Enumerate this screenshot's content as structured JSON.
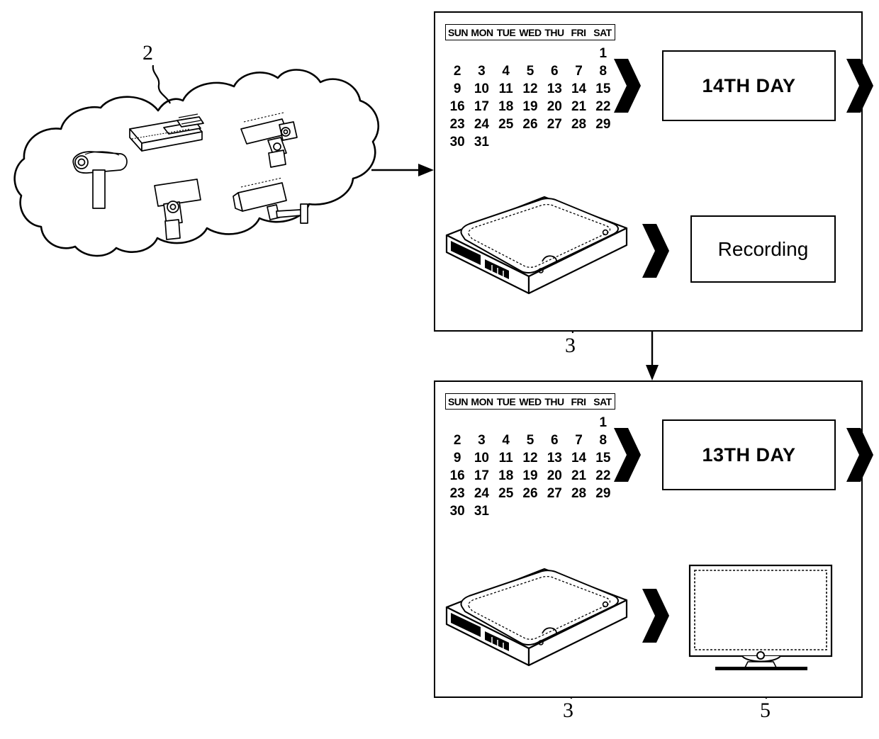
{
  "figure": {
    "type": "patent-diagram",
    "description": "Surveillance cloud with cameras feeding a recorder; two panels show day-14 recording and day-13 playback"
  },
  "cloud": {
    "label": "2",
    "name": "camera-network-cloud",
    "devices": [
      {
        "name": "network-recorder-device",
        "kind": "recorder"
      },
      {
        "name": "surveillance-camera-left",
        "kind": "camera"
      },
      {
        "name": "surveillance-camera-top-right",
        "kind": "camera"
      },
      {
        "name": "surveillance-camera-center",
        "kind": "camera"
      },
      {
        "name": "surveillance-camera-bottom-right",
        "kind": "camera"
      }
    ]
  },
  "calendar": {
    "weekdays": [
      "SUN",
      "MON",
      "TUE",
      "WED",
      "THU",
      "FRI",
      "SAT"
    ],
    "leading_blanks": 6,
    "days": [
      1,
      2,
      3,
      4,
      5,
      6,
      7,
      8,
      9,
      10,
      11,
      12,
      13,
      14,
      15,
      16,
      17,
      18,
      19,
      20,
      21,
      22,
      23,
      24,
      25,
      26,
      27,
      28,
      29,
      30,
      31
    ]
  },
  "panels": [
    {
      "id": "panel-top",
      "name": "recording-panel",
      "day_label": "14TH DAY",
      "action_label": "Recording",
      "storage_label": "3",
      "storage_name": "hard-disk-drive"
    },
    {
      "id": "panel-bottom",
      "name": "playback-panel",
      "day_label": "13TH DAY",
      "storage_label": "3",
      "storage_name": "hard-disk-drive",
      "display_label": "5",
      "display_name": "monitor-display"
    }
  ],
  "connectors": {
    "cloud_to_panel": {
      "name": "cloud-to-recorder-arrow",
      "direction": "right"
    },
    "panel_to_panel": {
      "name": "recording-to-playback-arrow",
      "direction": "down"
    }
  },
  "colors": {
    "line": "#000000",
    "fill": "#ffffff",
    "chevron": "#000000"
  }
}
